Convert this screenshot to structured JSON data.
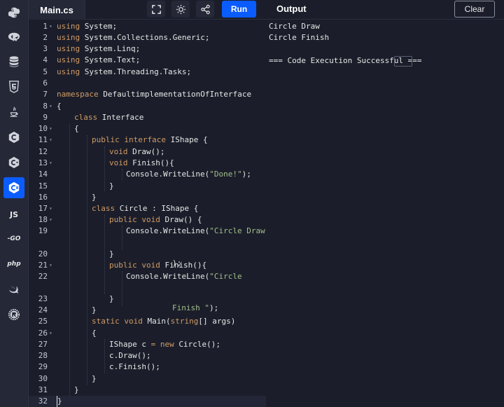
{
  "toolbar": {
    "file_tab": "Main.cs",
    "run_label": "Run",
    "output_title": "Output",
    "clear_label": "Clear"
  },
  "sidebar": {
    "languages": [
      {
        "name": "python",
        "icon": "python-icon"
      },
      {
        "name": "r",
        "icon": "r-icon"
      },
      {
        "name": "sql",
        "icon": "database-icon"
      },
      {
        "name": "html",
        "icon": "html5-icon"
      },
      {
        "name": "java",
        "icon": "java-icon"
      },
      {
        "name": "c",
        "icon": "c-icon"
      },
      {
        "name": "cpp",
        "icon": "cpp-icon"
      },
      {
        "name": "csharp",
        "icon": "csharp-icon",
        "active": true
      },
      {
        "name": "javascript",
        "icon": "js-icon",
        "label": "JS"
      },
      {
        "name": "go",
        "icon": "go-icon",
        "label": "-GO"
      },
      {
        "name": "php",
        "icon": "php-icon",
        "label": "php"
      },
      {
        "name": "swift",
        "icon": "swift-icon"
      },
      {
        "name": "rust",
        "icon": "rust-icon"
      }
    ]
  },
  "editor": {
    "line_numbers": [
      "1",
      "2",
      "3",
      "4",
      "5",
      "6",
      "7",
      "8",
      "9",
      "10",
      "11",
      "12",
      "13",
      "14",
      "15",
      "16",
      "17",
      "18",
      "19",
      "20",
      "21",
      "22",
      "23",
      "24",
      "25",
      "26",
      "27",
      "28",
      "29",
      "30",
      "31",
      "32"
    ],
    "lines": {
      "l1": [
        "using",
        " System;"
      ],
      "l2": [
        "using",
        " System.Collections.Generic;"
      ],
      "l3": [
        "using",
        " System.Linq;"
      ],
      "l4": [
        "using",
        " System.Text;"
      ],
      "l5": [
        "using",
        " System.Threading.Tasks;"
      ],
      "l7": [
        "namespace",
        " DefaultimplementationOfInterface"
      ],
      "l8": "{",
      "l9": [
        "class",
        " Interface"
      ],
      "l10": "{",
      "l11": [
        "public",
        " ",
        "interface",
        " IShape {"
      ],
      "l12": [
        "void",
        " Draw();"
      ],
      "l13": [
        "void",
        " Finish(){"
      ],
      "l14": [
        "Console.WriteLine(",
        "\"Done!\"",
        ");"
      ],
      "l15": "}",
      "l16": "}",
      "l17": [
        "class",
        " Circle : IShape {"
      ],
      "l18": [
        "public",
        " ",
        "void",
        " Draw() {"
      ],
      "l19a": [
        "Console.WriteLine(",
        "\"Circle Draw\""
      ],
      "l19b": ");",
      "l20": "}",
      "l21": [
        "public",
        " ",
        "void",
        " Finish(){"
      ],
      "l22a": [
        "Console.WriteLine(",
        "\"Circle"
      ],
      "l22b": [
        "Finish \"",
        ");"
      ],
      "l23": "}",
      "l24": "}",
      "l25": [
        "static",
        " ",
        "void",
        " Main(",
        "string",
        "[] args)"
      ],
      "l26": "{",
      "l27": [
        "IShape c ",
        "=",
        " ",
        "new",
        " Circle();"
      ],
      "l28": "c.Draw();",
      "l29": "c.Finish();",
      "l30": "}",
      "l31": "}",
      "l32": "}"
    }
  },
  "output": {
    "lines": [
      "Circle Draw",
      "Circle Finish",
      "",
      "=== Code Execution Successful ==="
    ]
  }
}
